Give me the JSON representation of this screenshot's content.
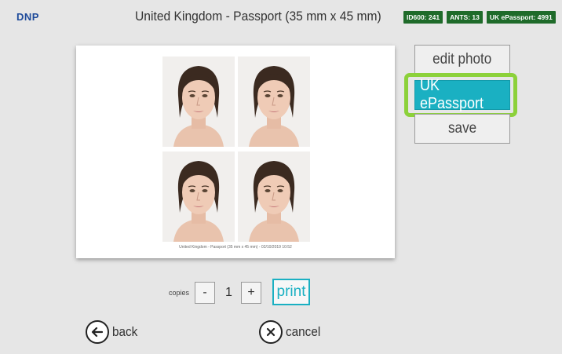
{
  "app": {
    "logo": "DNP",
    "title": "United Kingdom - Passport (35 mm x 45 mm)"
  },
  "badges": [
    {
      "label": "ID600: 241"
    },
    {
      "label": "ANTS: 13"
    },
    {
      "label": "UK ePassport: 4991"
    }
  ],
  "preview": {
    "caption": "United Kingdom - Passport (35 mm x 45 mm) - 02/10/2019 10:52",
    "photo_count": 4
  },
  "side_buttons": {
    "edit_photo": "edit photo",
    "uk_epassport": "UK ePassport",
    "save": "save"
  },
  "copies": {
    "label": "copies",
    "minus": "-",
    "value": "1",
    "plus": "+",
    "print": "print"
  },
  "nav": {
    "back": "back",
    "cancel": "cancel"
  },
  "colors": {
    "accent": "#1ab0c2",
    "highlight": "#8cd13a",
    "badge": "#1f6b2a",
    "logo": "#1e4a9a"
  }
}
